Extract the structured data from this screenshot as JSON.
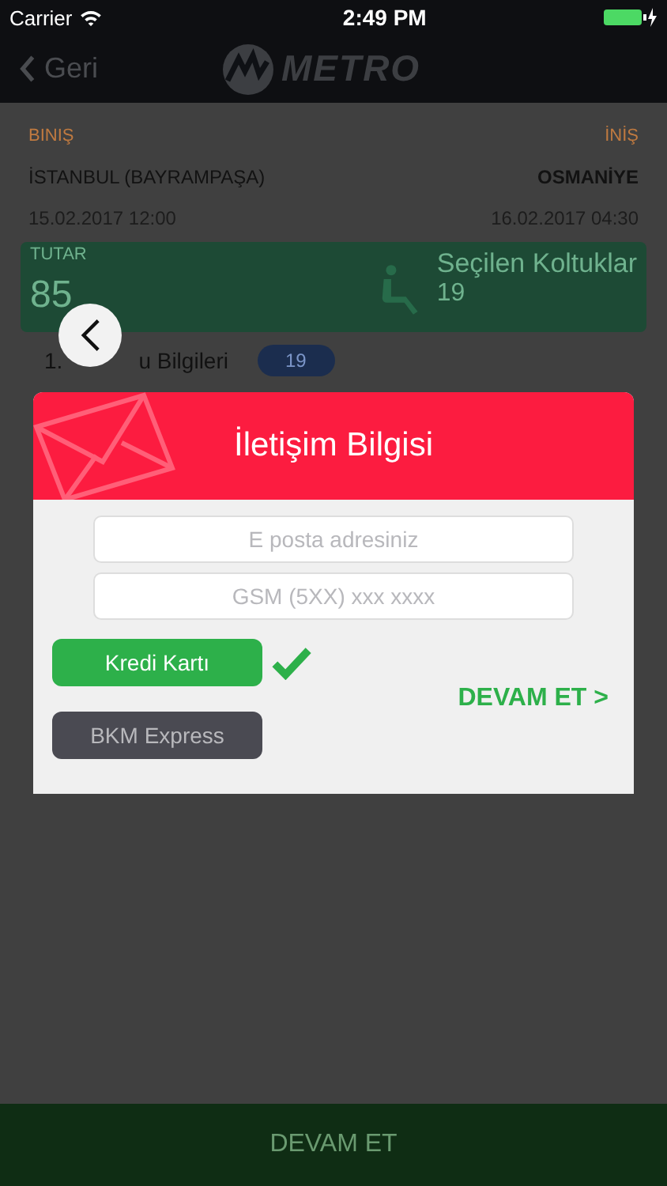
{
  "status_bar": {
    "carrier": "Carrier",
    "time": "2:49 PM"
  },
  "nav": {
    "back": "Geri",
    "logo": "METRO"
  },
  "route": {
    "from_label": "BINIŞ",
    "to_label": "İNİŞ",
    "from": "İSTANBUL (BAYRAMPAŞA)",
    "to": "OSMANİYE",
    "from_date": "15.02.2017 12:00",
    "to_date": "16.02.2017 04:30"
  },
  "summary": {
    "price_label": "TUTAR",
    "price": "85",
    "seats_label": "Seçilen Koltuklar",
    "seats": "19"
  },
  "passenger": {
    "number": "1.",
    "title": "u Bilgileri",
    "seat": "19"
  },
  "dialog": {
    "title": "İletişim Bilgisi",
    "fields": [
      {
        "placeholder": "E posta adresiniz"
      },
      {
        "placeholder": "GSM (5XX) xxx xxxx"
      }
    ],
    "payment_methods": [
      {
        "label": "Kredi Kartı",
        "selected": true
      },
      {
        "label": "BKM Express",
        "selected": false
      }
    ],
    "continue": "DEVAM ET >"
  },
  "footer_button": "DEVAM ET"
}
